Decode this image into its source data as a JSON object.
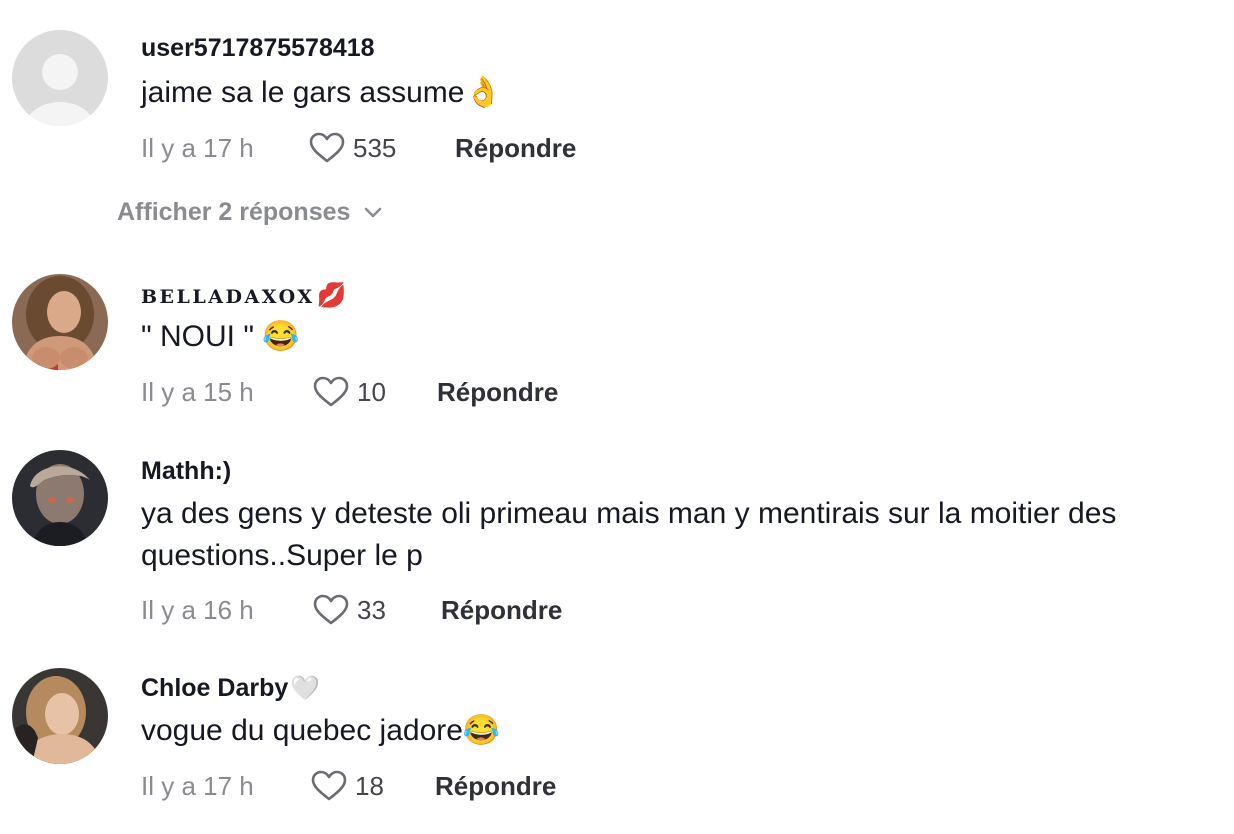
{
  "comments": [
    {
      "username": "user5717875578418",
      "username_emoji": "",
      "text": "jaime sa le gars assume👌",
      "time": "Il y a 17 h",
      "likes": "535",
      "reply_label": "Répondre"
    },
    {
      "username": "BELLADAXOX",
      "username_emoji": "💋",
      "text": "\" NOUI \" 😂",
      "time": "Il y a 15 h",
      "likes": "10",
      "reply_label": "Répondre"
    },
    {
      "username": "Mathh:)",
      "username_emoji": "",
      "text": "ya des gens y deteste oli primeau mais man y mentirais sur la moitier des questions..Super le p",
      "time": "Il y a 16 h",
      "likes": "33",
      "reply_label": "Répondre"
    },
    {
      "username": "Chloe Darby",
      "username_emoji": "🤍",
      "text": "vogue du quebec jadore😂",
      "time": "Il y a 17 h",
      "likes": "18",
      "reply_label": "Répondre"
    }
  ],
  "show_replies_label": "Afficher 2 réponses",
  "colors": {
    "text": "#161823",
    "muted": "#8a8b91",
    "placeholder_avatar": "#d9d9d9"
  },
  "icons": [
    "heart-outline-icon",
    "chevron-down-icon"
  ]
}
